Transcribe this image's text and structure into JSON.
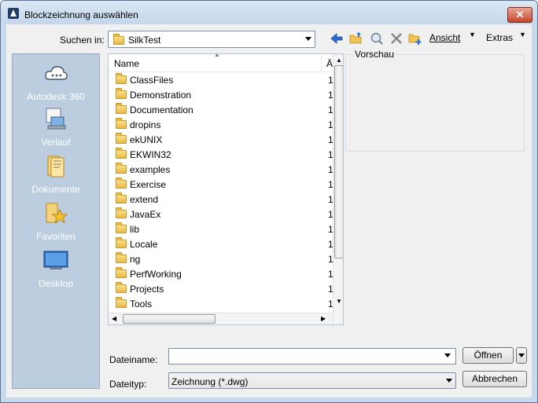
{
  "window": {
    "title": "Blockzeichnung auswählen",
    "close_glyph": "✕"
  },
  "toolbar": {
    "look_in_label": "Suchen in:",
    "look_in_value": "SilkTest",
    "view_menu": "Ansicht",
    "tools_menu": "Extras"
  },
  "places": [
    {
      "label": "Autodesk 360",
      "icon": "cloud-icon"
    },
    {
      "label": "Verlauf",
      "icon": "history-icon"
    },
    {
      "label": "Dokumente",
      "icon": "documents-icon"
    },
    {
      "label": "Favoriten",
      "icon": "favorites-icon"
    },
    {
      "label": "Desktop",
      "icon": "desktop-icon"
    }
  ],
  "file_list": {
    "column_name": "Name",
    "column_date": "Ä",
    "items": [
      {
        "name": "ClassFiles",
        "date": "1"
      },
      {
        "name": "Demonstration",
        "date": "1"
      },
      {
        "name": "Documentation",
        "date": "1"
      },
      {
        "name": "dropins",
        "date": "1"
      },
      {
        "name": "ekUNIX",
        "date": "1"
      },
      {
        "name": "EKWIN32",
        "date": "1"
      },
      {
        "name": "examples",
        "date": "1"
      },
      {
        "name": "Exercise",
        "date": "1"
      },
      {
        "name": "extend",
        "date": "1"
      },
      {
        "name": "JavaEx",
        "date": "1"
      },
      {
        "name": "lib",
        "date": "1"
      },
      {
        "name": "Locale",
        "date": "1"
      },
      {
        "name": "ng",
        "date": "1"
      },
      {
        "name": "PerfWorking",
        "date": "1"
      },
      {
        "name": "Projects",
        "date": "1"
      },
      {
        "name": "Tools",
        "date": "1"
      }
    ]
  },
  "preview": {
    "label": "Vorschau"
  },
  "footer": {
    "filename_label": "Dateiname:",
    "filename_value": "",
    "filetype_label": "Dateityp:",
    "filetype_value": "Zeichnung (*.dwg)",
    "open_button": "Öffnen",
    "cancel_button": "Abbrechen"
  }
}
